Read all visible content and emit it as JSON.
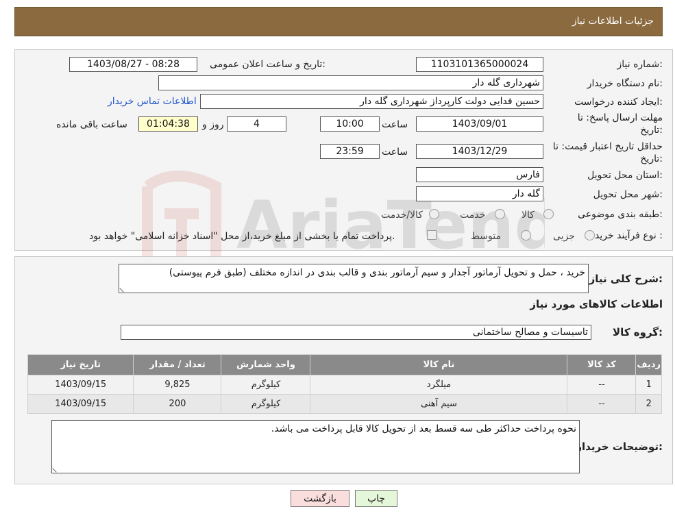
{
  "header": {
    "title": "جزئیات اطلاعات نیاز"
  },
  "form": {
    "need_number_label": "شماره نیاز:",
    "need_number": "1103101365000024",
    "announce_label": "تاریخ و ساعت اعلان عمومی:",
    "announce_value": "1403/08/27 - 08:28",
    "buyer_label": "نام دستگاه خریدار:",
    "buyer_value": "شهرداری گله دار",
    "creator_label": "ایجاد کننده درخواست:",
    "creator_value": "حسین فدایی دولت کارپرداز شهرداری گله دار",
    "contact_link": "اطلاعات تماس خریدار",
    "deadline_label_1": "مهلت ارسال پاسخ: تا",
    "deadline_label_2": "تاریخ:",
    "deadline_date": "1403/09/01",
    "hour_label": "ساعت",
    "deadline_time": "10:00",
    "days_value": "4",
    "days_label": "روز و",
    "remaining_value": "01:04:38",
    "remaining_label": "ساعت باقی مانده",
    "validity_label_1": "حداقل تاریخ اعتبار قیمت: تا",
    "validity_label_2": "تاریخ:",
    "validity_date": "1403/12/29",
    "validity_time": "23:59",
    "province_label": "استان محل تحویل:",
    "province_value": "فارس",
    "city_label": "شهر محل تحویل:",
    "city_value": "گله دار",
    "category_label": "طبقه بندی موضوعی:",
    "category_options": [
      "کالا",
      "خدمت",
      "کالا/خدمت"
    ],
    "process_label": "نوع فرآیند خرید :",
    "process_options": [
      "جزیی",
      "متوسط"
    ],
    "payment_note": "پرداخت تمام یا بخشی از مبلغ خرید،از محل \"اسناد خزانه اسلامی\" خواهد بود."
  },
  "details": {
    "summary_label": "شرح کلی نیاز:",
    "summary_value": "خرید ، حمل و تحویل آرماتور آجدار و سیم آرماتور بندی و قالب بندی در اندازه مختلف (طبق فرم پیوستی)",
    "goods_info_title": "اطلاعات کالاهای مورد نیاز",
    "goods_group_label": "گروه کالا:",
    "goods_group_value": "تاسیسات و مصالح ساختمانی",
    "table": {
      "headers": [
        "ردیف",
        "کد کالا",
        "نام کالا",
        "واحد شمارش",
        "تعداد / مقدار",
        "تاریخ نیاز"
      ],
      "rows": [
        [
          "1",
          "--",
          "میلگرد",
          "کیلوگرم",
          "9,825",
          "1403/09/15"
        ],
        [
          "2",
          "--",
          "سیم آهنی",
          "کیلوگرم",
          "200",
          "1403/09/15"
        ]
      ]
    },
    "buyer_notes_label": "توضیحات خریدار:",
    "buyer_notes_value": "نحوه پرداخت حداکثر طی سه قسط بعد از تحویل کالا قابل پرداخت می باشد."
  },
  "buttons": {
    "print": "چاپ",
    "back": "بازگشت"
  },
  "watermark": {
    "text": "AriaTender.neT"
  },
  "colors": {
    "header_bg": "#8a6a3e",
    "table_header_bg": "#8a8a8a",
    "link": "#2255cc",
    "back_btn_bg": "#fadddd",
    "print_btn_bg": "#e5f7d9"
  }
}
